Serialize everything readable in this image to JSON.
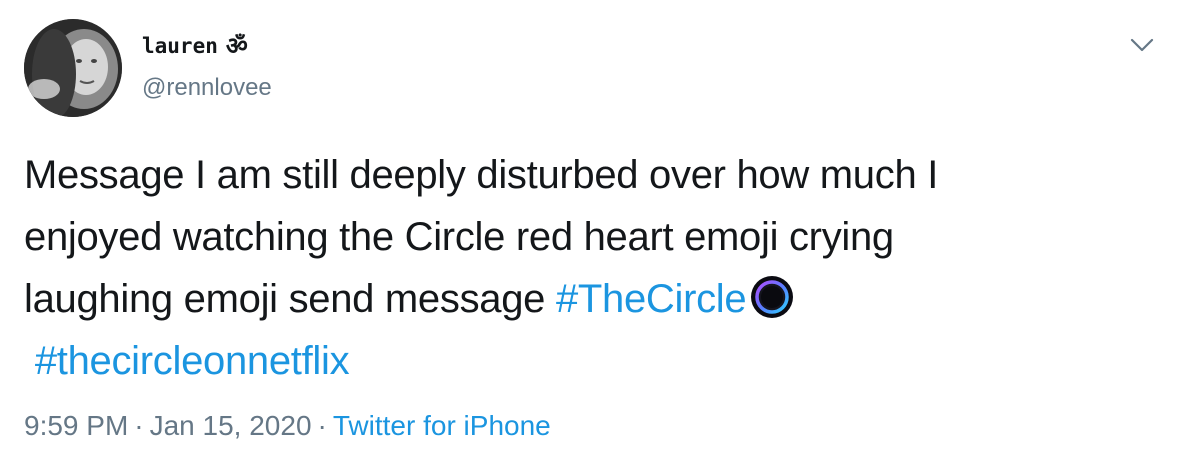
{
  "user": {
    "display_name": "lauren",
    "display_name_glyph": "ॐ",
    "handle": "@rennlovee"
  },
  "tweet": {
    "line1": "Message I am still deeply disturbed over how much I",
    "line2": "enjoyed watching the Circle red heart emoji crying",
    "line3_text": "laughing emoji send message ",
    "hashtag1": "#TheCircle",
    "hashtag2": "#thecircleonnetflix"
  },
  "meta": {
    "time": "9:59 PM",
    "separator": "·",
    "date": "Jan 15, 2020",
    "source": "Twitter for iPhone"
  },
  "icons": {
    "caret": "chevron-down-icon",
    "hashtag_emoji": "the-circle-icon"
  },
  "colors": {
    "text": "#14171a",
    "secondary": "#657786",
    "link": "#1b95e0"
  }
}
